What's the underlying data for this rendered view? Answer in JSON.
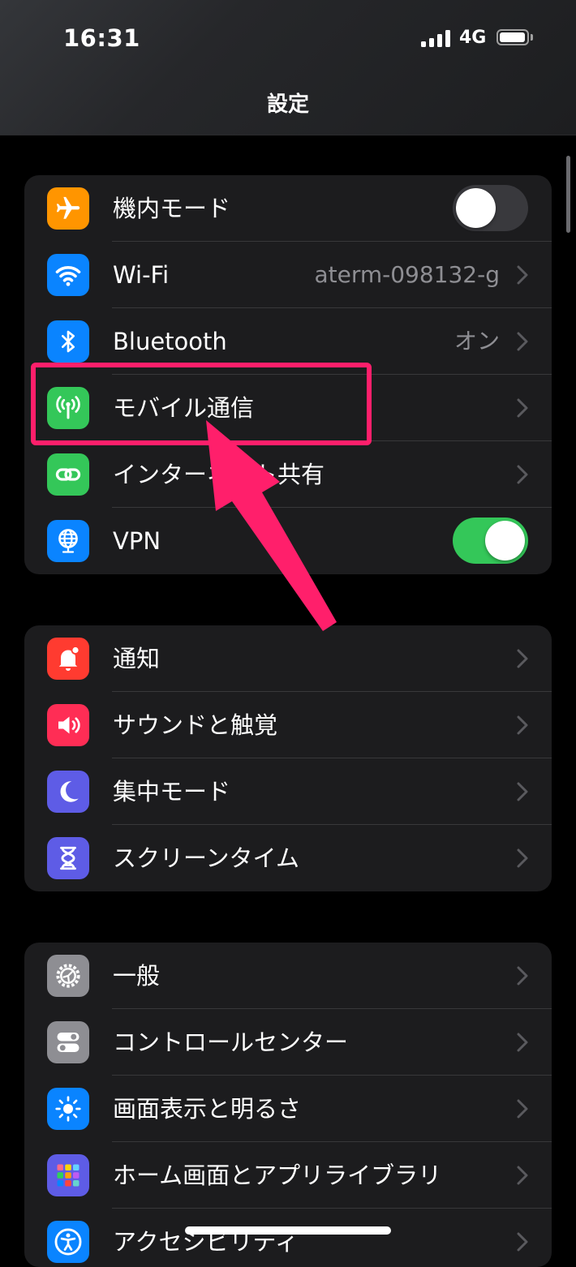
{
  "status_bar": {
    "time": "16:31",
    "network": "4G"
  },
  "header": {
    "title": "設定"
  },
  "groups": [
    {
      "items": [
        {
          "label": "機内モード",
          "icon": "airplane-icon",
          "color": "#ff9500",
          "control": "toggle",
          "toggle_on": false
        },
        {
          "label": "Wi-Fi",
          "icon": "wifi-icon",
          "color": "#0a84ff",
          "value": "aterm-098132-g"
        },
        {
          "label": "Bluetooth",
          "icon": "bluetooth-icon",
          "color": "#0a84ff",
          "value": "オン"
        },
        {
          "label": "モバイル通信",
          "icon": "antenna-icon",
          "color": "#34c759"
        },
        {
          "label": "インターネット共有",
          "icon": "link-icon",
          "color": "#34c759"
        },
        {
          "label": "VPN",
          "icon": "globe-icon",
          "color": "#0a84ff",
          "control": "toggle",
          "toggle_on": true
        }
      ]
    },
    {
      "items": [
        {
          "label": "通知",
          "icon": "bell-icon",
          "color": "#ff3b30"
        },
        {
          "label": "サウンドと触覚",
          "icon": "speaker-icon",
          "color": "#ff2d55"
        },
        {
          "label": "集中モード",
          "icon": "moon-icon",
          "color": "#5e5ce6"
        },
        {
          "label": "スクリーンタイム",
          "icon": "hourglass-icon",
          "color": "#5e5ce6"
        }
      ]
    },
    {
      "items": [
        {
          "label": "一般",
          "icon": "gear-icon",
          "color": "#8e8e93"
        },
        {
          "label": "コントロールセンター",
          "icon": "switches-icon",
          "color": "#8e8e93"
        },
        {
          "label": "画面表示と明るさ",
          "icon": "sun-icon",
          "color": "#0a84ff"
        },
        {
          "label": "ホーム画面とアプリライブラリ",
          "icon": "app-grid-icon",
          "color": "#5e5ce6"
        },
        {
          "label": "アクセシビリティ",
          "icon": "accessibility-icon",
          "color": "#0a84ff"
        }
      ]
    }
  ],
  "annotation": {
    "color": "#ff1f6b",
    "target": "モバイル通信"
  }
}
